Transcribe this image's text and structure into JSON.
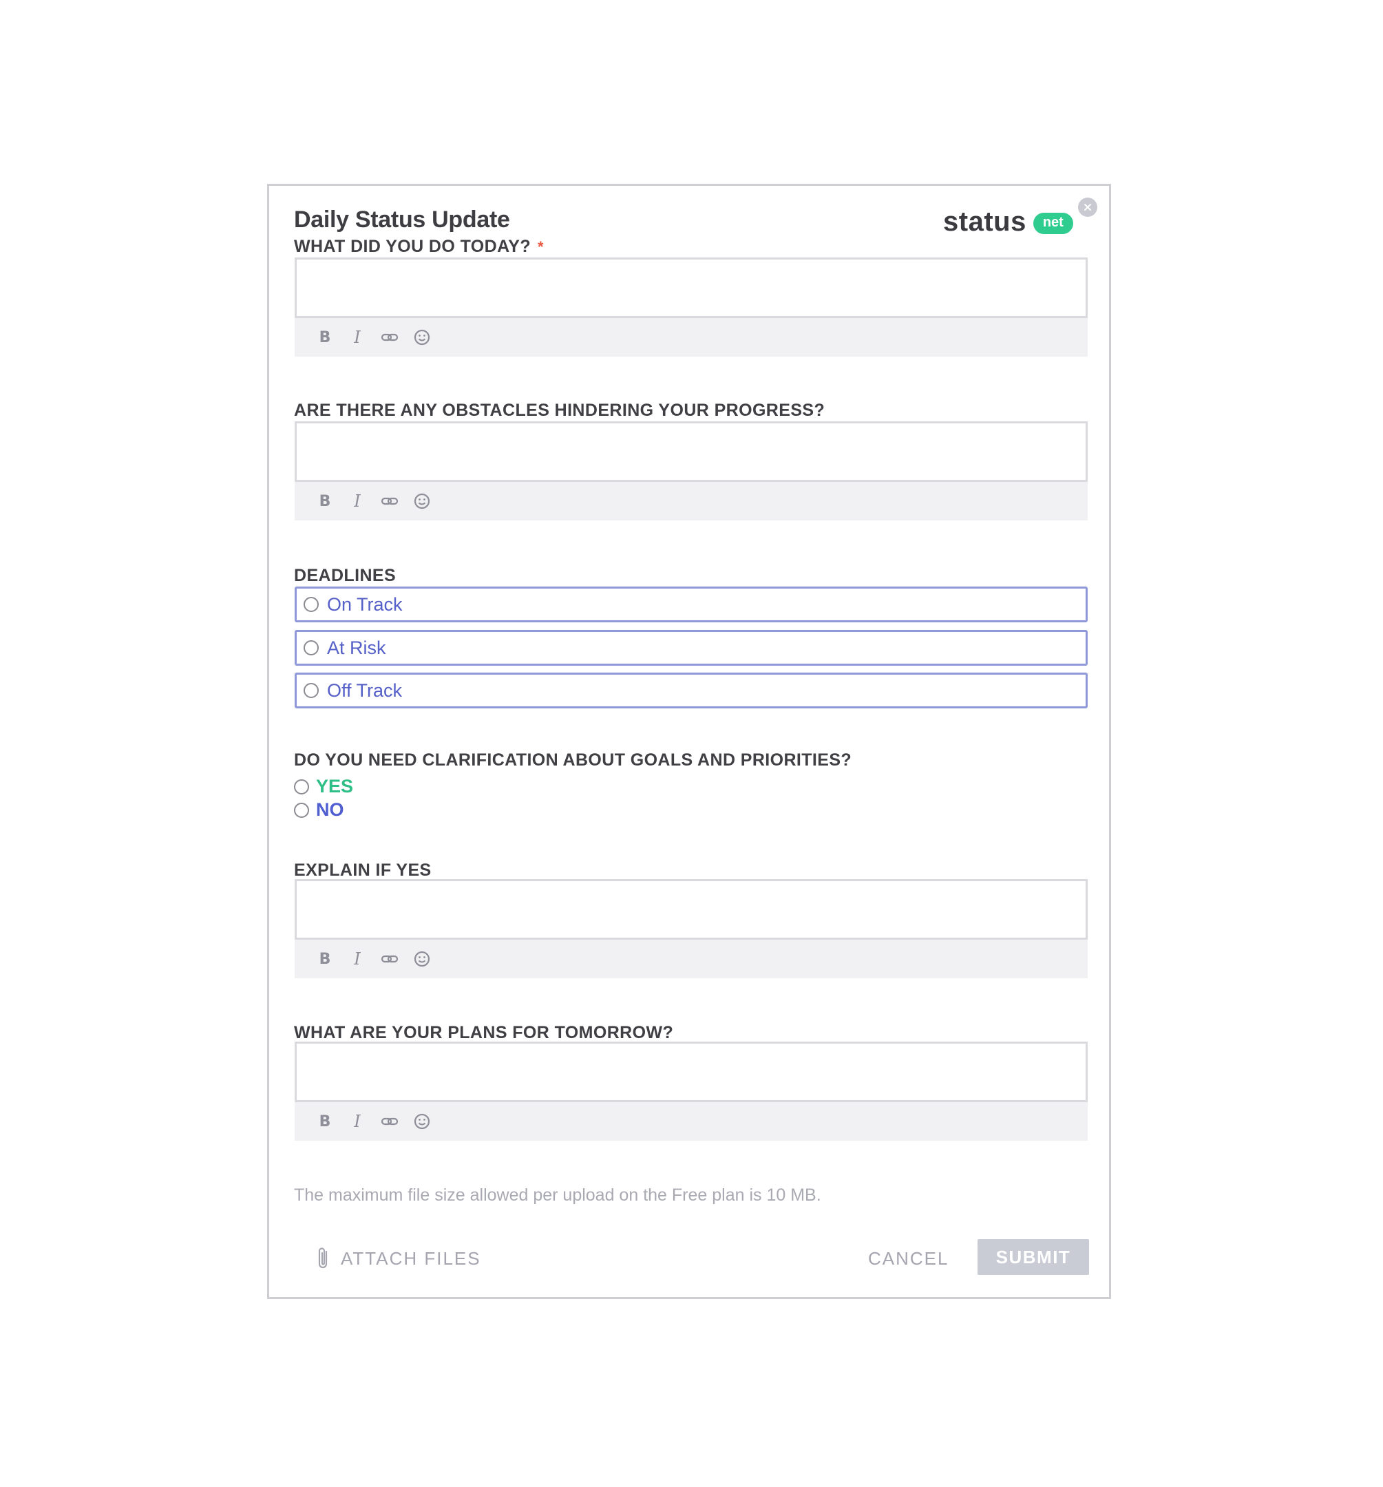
{
  "form": {
    "title": "Daily Status Update",
    "logo": {
      "word": "status",
      "badge": "net",
      "badge_color": "#2ecc8f"
    },
    "required_marker": "*",
    "questions": [
      {
        "label": "WHAT DID YOU DO TODAY?",
        "required": true
      },
      {
        "label": "ARE THERE ANY OBSTACLES HINDERING YOUR PROGRESS?"
      },
      {
        "label": "DEADLINES"
      },
      {
        "label": "DO YOU NEED CLARIFICATION ABOUT GOALS AND PRIORITIES?"
      },
      {
        "label": "EXPLAIN IF YES"
      },
      {
        "label": "WHAT ARE YOUR PLANS FOR TOMORROW?"
      }
    ],
    "toolbar": {
      "bold": "B",
      "italic": "I"
    },
    "deadlines": [
      "On Track",
      "At Risk",
      "Off Track"
    ],
    "clarification": [
      "YES",
      "NO"
    ],
    "file_note": "The maximum file size allowed per upload on the Free plan is 10 MB.",
    "attach_label": "ATTACH FILES",
    "cancel_label": "CANCEL",
    "submit_label": "SUBMIT"
  },
  "colors": {
    "radio_accent": "#5560c8",
    "yes": "#2dbf86",
    "no": "#4f5ed1",
    "required": "#e8553f"
  }
}
